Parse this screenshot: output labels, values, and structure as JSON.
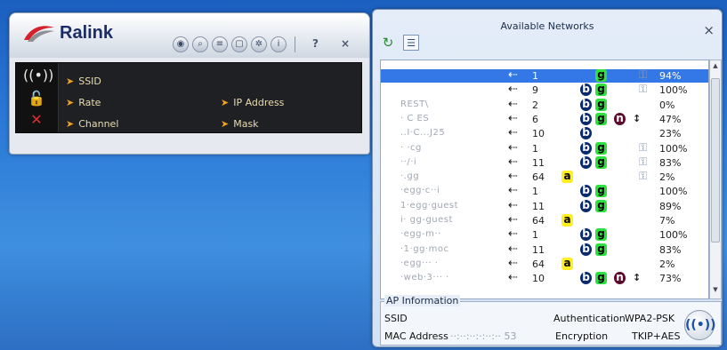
{
  "ralink": {
    "logo_text": "Ralink",
    "toolbar_icons": [
      "rss-icon",
      "search-icon",
      "list-icon",
      "page-icon",
      "gear-icon",
      "info-icon"
    ],
    "help_label": "?",
    "close_label": "×",
    "fields": {
      "ssid": "SSID",
      "rate": "Rate",
      "channel": "Channel",
      "ip": "IP Address",
      "mask": "Mask"
    }
  },
  "networks": {
    "title": "Available Networks",
    "close_label": "×",
    "rows": [
      {
        "ssid": "",
        "ch": "1",
        "a": false,
        "b": false,
        "g": true,
        "n": false,
        "wps": false,
        "key": true,
        "pct": "94%",
        "selected": true
      },
      {
        "ssid": "",
        "ch": "9",
        "a": false,
        "b": true,
        "g": true,
        "n": false,
        "wps": false,
        "key": true,
        "pct": "100%",
        "selected": false
      },
      {
        "ssid": "REST\\",
        "ch": "2",
        "a": false,
        "b": true,
        "g": true,
        "n": false,
        "wps": false,
        "key": false,
        "pct": "0%",
        "selected": false
      },
      {
        "ssid": "· C ES",
        "ch": "6",
        "a": false,
        "b": true,
        "g": true,
        "n": true,
        "wps": true,
        "key": false,
        "pct": "47%",
        "selected": false
      },
      {
        "ssid": "..I·C...J25",
        "ch": "10",
        "a": false,
        "b": true,
        "g": false,
        "n": false,
        "wps": false,
        "key": false,
        "pct": "23%",
        "selected": false
      },
      {
        "ssid": "· ·cg",
        "ch": "1",
        "a": false,
        "b": true,
        "g": true,
        "n": false,
        "wps": false,
        "key": true,
        "pct": "100%",
        "selected": false
      },
      {
        "ssid": "··/·i",
        "ch": "11",
        "a": false,
        "b": true,
        "g": true,
        "n": false,
        "wps": false,
        "key": true,
        "pct": "83%",
        "selected": false
      },
      {
        "ssid": "·.gg",
        "ch": "64",
        "a": true,
        "b": false,
        "g": false,
        "n": false,
        "wps": false,
        "key": true,
        "pct": "2%",
        "selected": false
      },
      {
        "ssid": "·egg·c··i",
        "ch": "1",
        "a": false,
        "b": true,
        "g": true,
        "n": false,
        "wps": false,
        "key": false,
        "pct": "100%",
        "selected": false
      },
      {
        "ssid": "1·egg·guest",
        "ch": "11",
        "a": false,
        "b": true,
        "g": true,
        "n": false,
        "wps": false,
        "key": false,
        "pct": "89%",
        "selected": false
      },
      {
        "ssid": "i· gg-guest",
        "ch": "64",
        "a": true,
        "b": false,
        "g": false,
        "n": false,
        "wps": false,
        "key": false,
        "pct": "7%",
        "selected": false
      },
      {
        "ssid": "·egg-m··",
        "ch": "1",
        "a": false,
        "b": true,
        "g": true,
        "n": false,
        "wps": false,
        "key": false,
        "pct": "100%",
        "selected": false
      },
      {
        "ssid": "·1·gg·moc",
        "ch": "11",
        "a": false,
        "b": true,
        "g": true,
        "n": false,
        "wps": false,
        "key": false,
        "pct": "83%",
        "selected": false
      },
      {
        "ssid": "·egg··· ·",
        "ch": "64",
        "a": true,
        "b": false,
        "g": false,
        "n": false,
        "wps": false,
        "key": false,
        "pct": "2%",
        "selected": false
      },
      {
        "ssid": "·web·3··· ·",
        "ch": "10",
        "a": false,
        "b": true,
        "g": true,
        "n": true,
        "wps": true,
        "key": false,
        "pct": "73%",
        "selected": false
      }
    ]
  },
  "ap_info": {
    "legend": "AP Information",
    "ssid_label": "SSID",
    "auth_label": "Authentication",
    "auth_value": "WPA2-PSK",
    "mac_label": "MAC Address",
    "mac_value": "··:··:··:·:··:·· 53",
    "enc_label": "Encryption",
    "enc_value": "TKIP+AES"
  }
}
